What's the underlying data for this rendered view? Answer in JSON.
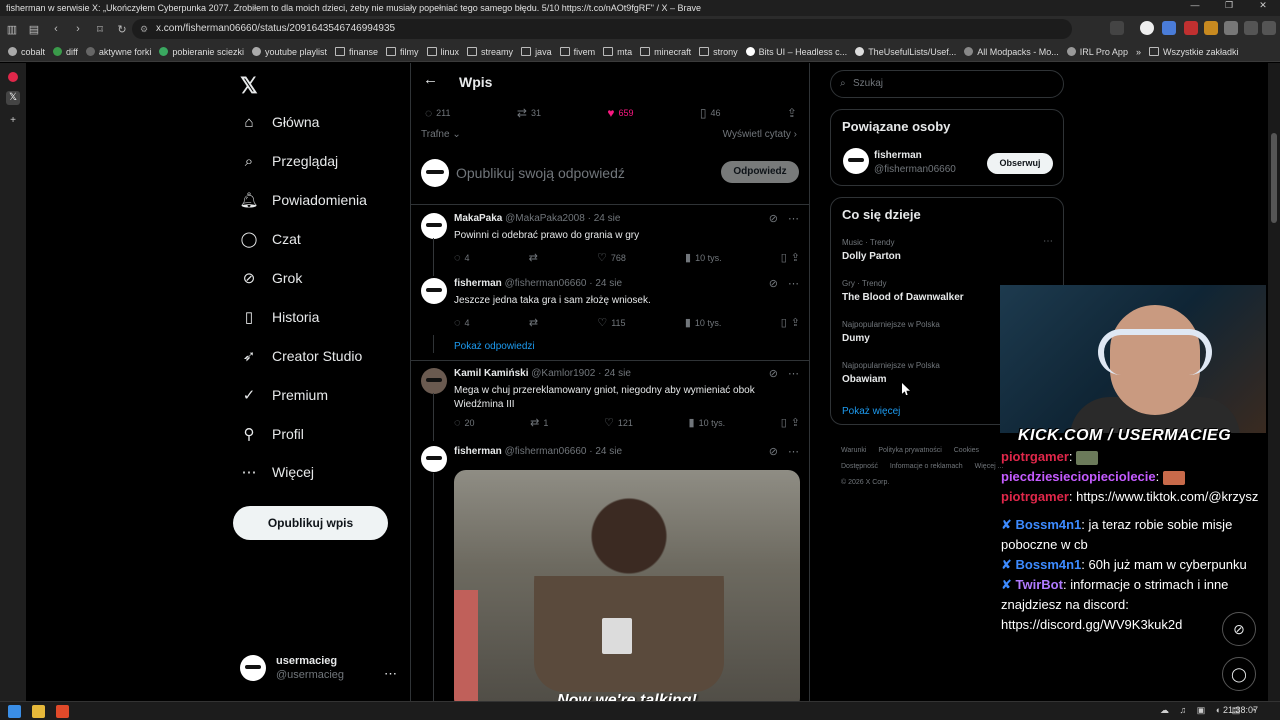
{
  "browser": {
    "window_title": "fisherman w serwisie X: „Ukończyłem Cyberpunka 2077. Zrobiłem to dla moich dzieci, żeby nie musiały popełniać tego samego błędu. 5/10 https://t.co/nAOt9fgRF\" / X – Brave",
    "url": "x.com/fisherman06660/status/2091643546746994935",
    "bookmarks": [
      "cobalt",
      "diff",
      "aktywne forki",
      "pobieranie sciezki",
      "youtube playlist",
      "finanse",
      "filmy",
      "linux",
      "streamy",
      "java",
      "fivem",
      "mta",
      "minecraft",
      "strony",
      "Bits UI – Headless c...",
      "TheUsefulLists/Usef...",
      "All Modpacks - Mo...",
      "IRL Pro App"
    ],
    "bookmarks_other": "Wszystkie zakładki"
  },
  "sidebar": {
    "logo": "X",
    "items": [
      {
        "label": "Główna",
        "icon": "home-icon"
      },
      {
        "label": "Przeglądaj",
        "icon": "search-icon"
      },
      {
        "label": "Powiadomienia",
        "icon": "bell-icon"
      },
      {
        "label": "Czat",
        "icon": "chat-icon"
      },
      {
        "label": "Grok",
        "icon": "grok-icon"
      },
      {
        "label": "Historia",
        "icon": "bookmark-icon"
      },
      {
        "label": "Creator Studio",
        "icon": "rocket-icon"
      },
      {
        "label": "Premium",
        "icon": "verified-icon"
      },
      {
        "label": "Profil",
        "icon": "profile-icon"
      },
      {
        "label": "Więcej",
        "icon": "more-icon"
      }
    ],
    "post_button": "Opublikuj wpis",
    "account": {
      "name": "usermacieg",
      "handle": "@usermacieg"
    }
  },
  "main": {
    "title": "Wpis",
    "stats": {
      "replies": "211",
      "reposts": "31",
      "likes": "659",
      "bookmarks": "46"
    },
    "sort_label": "Trafne",
    "quotes_label": "Wyświetl cytaty",
    "reply_placeholder": "Opublikuj swoją odpowiedź",
    "reply_button": "Odpowiedz",
    "tweets": [
      {
        "name": "MakaPaka",
        "handle": "@MakaPaka2008",
        "date": "· 24 sie",
        "text": "Powinni ci odebrać prawo do grania w gry",
        "replies": "4",
        "reposts": "",
        "likes": "768",
        "views": "10 tys."
      },
      {
        "name": "fisherman",
        "handle": "@fisherman06660",
        "date": "· 24 sie",
        "text": "Jeszcze jedna taka gra i sam złożę wniosek.",
        "replies": "4",
        "reposts": "",
        "likes": "115",
        "views": "10 tys."
      },
      {
        "name": "Kamil Kamiński",
        "handle": "@Kamlor1902",
        "date": "· 24 sie",
        "text": "Mega w chuj przereklamowany gniot, niegodny aby wymieniać obok Wiedźmina III",
        "replies": "20",
        "reposts": "1",
        "likes": "121",
        "views": "10 tys."
      },
      {
        "name": "fisherman",
        "handle": "@fisherman06660",
        "date": "· 24 sie",
        "text": "",
        "media_caption": "Now we're talking!"
      }
    ],
    "show_replies": "Pokaż odpowiedzi"
  },
  "right": {
    "search_placeholder": "Szukaj",
    "related_title": "Powiązane osoby",
    "related": {
      "name": "fisherman",
      "handle": "@fisherman06660",
      "follow": "Obserwuj"
    },
    "trends_title": "Co się dzieje",
    "trends": [
      {
        "category": "Music · Trendy",
        "name": "Dolly Parton"
      },
      {
        "category": "Gry · Trendy",
        "name": "The Blood of Dawnwalker"
      },
      {
        "category": "Najpopularniejsze w Polska",
        "name": "Dumy"
      },
      {
        "category": "Najpopularniejsze w Polska",
        "name": "Obawiam"
      }
    ],
    "show_more": "Pokaż więcej",
    "footer": [
      "Warunki",
      "Polityka prywatności",
      "Cookies",
      "Dostępność",
      "Informacje o reklamach",
      "Więcej ...",
      "© 2026 X Corp."
    ]
  },
  "overlay": {
    "kick": "KICK.COM / USERMACIEG",
    "chat": [
      {
        "user": "piotrgamer",
        "color": "#e0274a",
        "text": "",
        "emote": "#6b7a5a"
      },
      {
        "user": "piecdziesieciopieciolecie",
        "color": "#c45bff",
        "text": "",
        "emote": "#c86a4a"
      },
      {
        "user": "piotrgamer",
        "color": "#e0274a",
        "text": "https://www.tiktok.com/@krzysz"
      },
      {
        "user": "Bossm4n1",
        "color": "#3d8bff",
        "text": "ja teraz robie sobie misje poboczne w cb",
        "badge": "✘"
      },
      {
        "user": "Bossm4n1",
        "color": "#3d8bff",
        "text": "60h już mam w cyberpunku",
        "badge": "✘"
      },
      {
        "user": "TwirBot",
        "color": "#b07bff",
        "text": "informacje o strimach i inne znajdziesz na discord: https://discord.gg/WV9K3kuk2d",
        "badge": "✘"
      }
    ]
  },
  "taskbar": {
    "clock": "21:38:07"
  },
  "colors": {
    "accent": "#1d9bf0",
    "like": "#f91880",
    "bg": "#000000"
  }
}
